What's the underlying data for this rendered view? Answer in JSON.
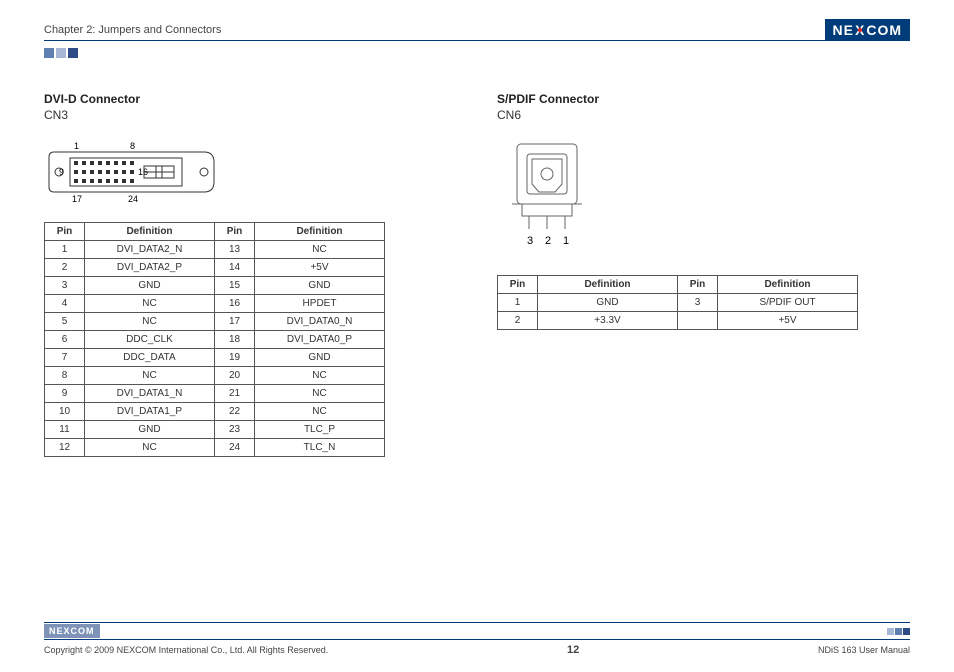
{
  "header": {
    "chapter": "Chapter 2: Jumpers and Connectors",
    "logo_text": "NE COM",
    "logo_x": "X"
  },
  "dvi": {
    "title": "DVI-D Connector",
    "sub": "CN3",
    "diagram_labels": {
      "tl": "1",
      "tr": "8",
      "ml": "9",
      "mr": "16",
      "bl": "17",
      "br": "24"
    },
    "headers": [
      "Pin",
      "Definition",
      "Pin",
      "Definition"
    ],
    "rows": [
      [
        "1",
        "DVI_DATA2_N",
        "13",
        "NC"
      ],
      [
        "2",
        "DVI_DATA2_P",
        "14",
        "+5V"
      ],
      [
        "3",
        "GND",
        "15",
        "GND"
      ],
      [
        "4",
        "NC",
        "16",
        "HPDET"
      ],
      [
        "5",
        "NC",
        "17",
        "DVI_DATA0_N"
      ],
      [
        "6",
        "DDC_CLK",
        "18",
        "DVI_DATA0_P"
      ],
      [
        "7",
        "DDC_DATA",
        "19",
        "GND"
      ],
      [
        "8",
        "NC",
        "20",
        "NC"
      ],
      [
        "9",
        "DVI_DATA1_N",
        "21",
        "NC"
      ],
      [
        "10",
        "DVI_DATA1_P",
        "22",
        "NC"
      ],
      [
        "11",
        "GND",
        "23",
        "TLC_P"
      ],
      [
        "12",
        "NC",
        "24",
        "TLC_N"
      ]
    ]
  },
  "spdif": {
    "title": "S/PDIF Connector",
    "sub": "CN6",
    "diagram_labels": {
      "l3": "3",
      "l2": "2",
      "l1": "1"
    },
    "headers": [
      "Pin",
      "Definition",
      "Pin",
      "Definition"
    ],
    "rows": [
      [
        "1",
        "GND",
        "3",
        "S/PDIF OUT"
      ],
      [
        "2",
        "+3.3V",
        "",
        "+5V"
      ]
    ]
  },
  "footer": {
    "logo_text": "NE COM",
    "logo_x": "X",
    "copyright": "Copyright © 2009 NEXCOM International Co., Ltd. All Rights Reserved.",
    "page": "12",
    "manual": "NDiS 163 User Manual"
  }
}
